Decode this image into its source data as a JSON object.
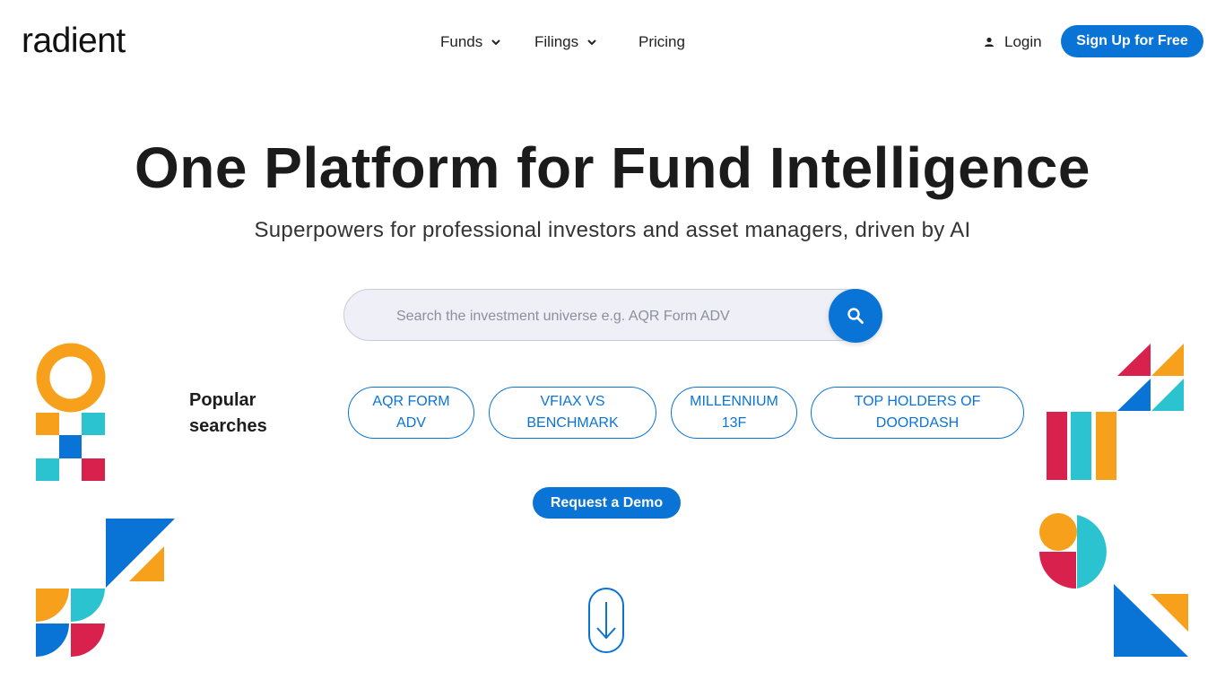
{
  "header": {
    "logo_text": "radient",
    "nav": [
      {
        "label": "Funds"
      },
      {
        "label": "Filings"
      },
      {
        "label": "Pricing"
      }
    ],
    "login_label": "Login",
    "signup_label": "Sign Up for Free"
  },
  "hero": {
    "headline": "One Platform for Fund Intelligence",
    "subheadline": "Superpowers for professional investors and asset managers, driven by AI"
  },
  "search": {
    "placeholder": "Search the investment universe e.g. AQR Form ADV",
    "value": ""
  },
  "popular": {
    "label": "Popular searches",
    "chips": [
      "AQR FORM ADV",
      "VFIAX VS BENCHMARK",
      "MILLENNIUM 13F",
      "TOP HOLDERS OF DOORDASH"
    ]
  },
  "cta": {
    "demo_label": "Request a Demo"
  },
  "colors": {
    "accent": "#0a74d6",
    "orange": "#f7a01b",
    "teal": "#2bc3cf",
    "red": "#d9214d",
    "blue": "#0a74d6"
  },
  "icons": [
    "chevron-down-icon",
    "user-icon",
    "search-icon",
    "arrow-down-icon"
  ]
}
